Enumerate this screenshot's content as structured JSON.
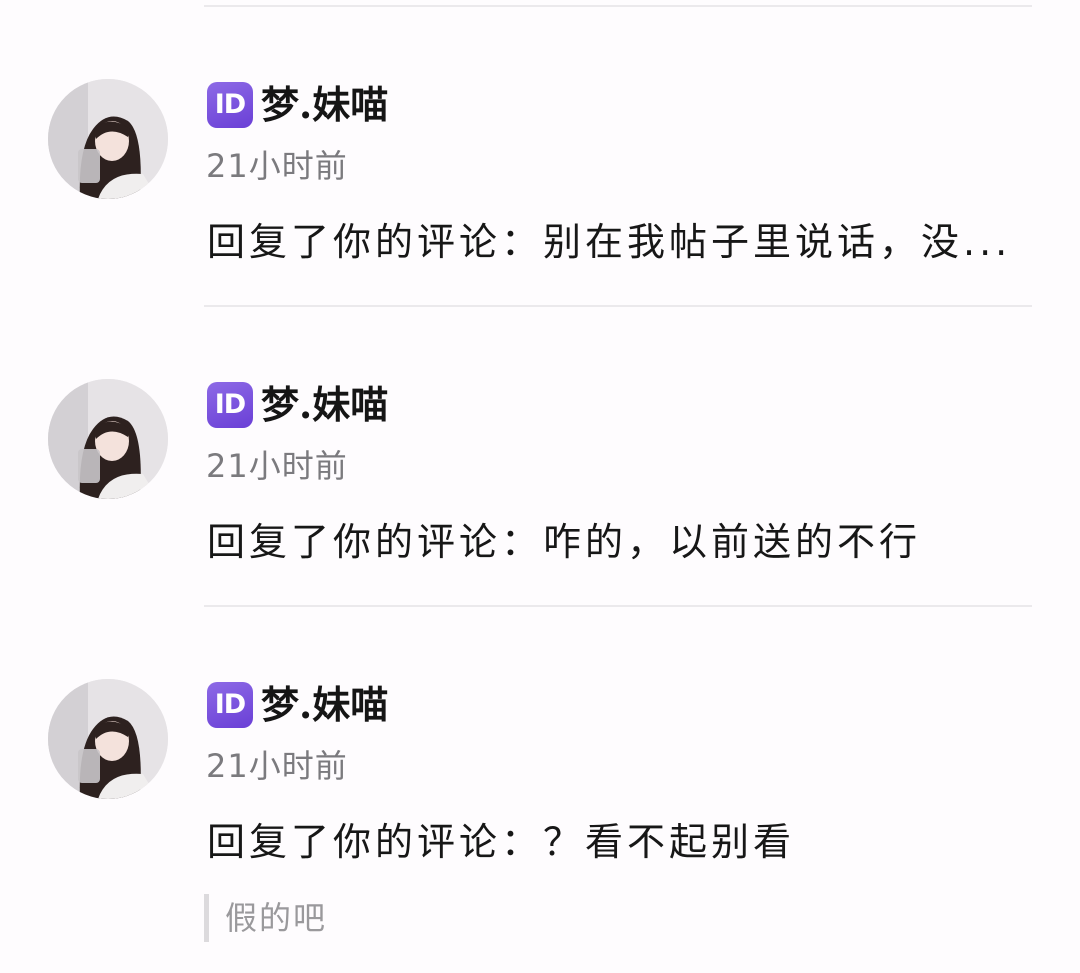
{
  "notifications": [
    {
      "badge": "ID",
      "username": "梦.妹喵",
      "time": "21小时前",
      "comment": "回复了你的评论：别在我帖子里说话，没..."
    },
    {
      "badge": "ID",
      "username": "梦.妹喵",
      "time": "21小时前",
      "comment": "回复了你的评论：咋的，以前送的不行"
    },
    {
      "badge": "ID",
      "username": "梦.妹喵",
      "time": "21小时前",
      "comment": "回复了你的评论：？看不起别看",
      "quote": "假的吧"
    }
  ],
  "colors": {
    "background": "#fefcfe",
    "id_badge": "#7a52de",
    "divider": "#ebe9ec"
  }
}
